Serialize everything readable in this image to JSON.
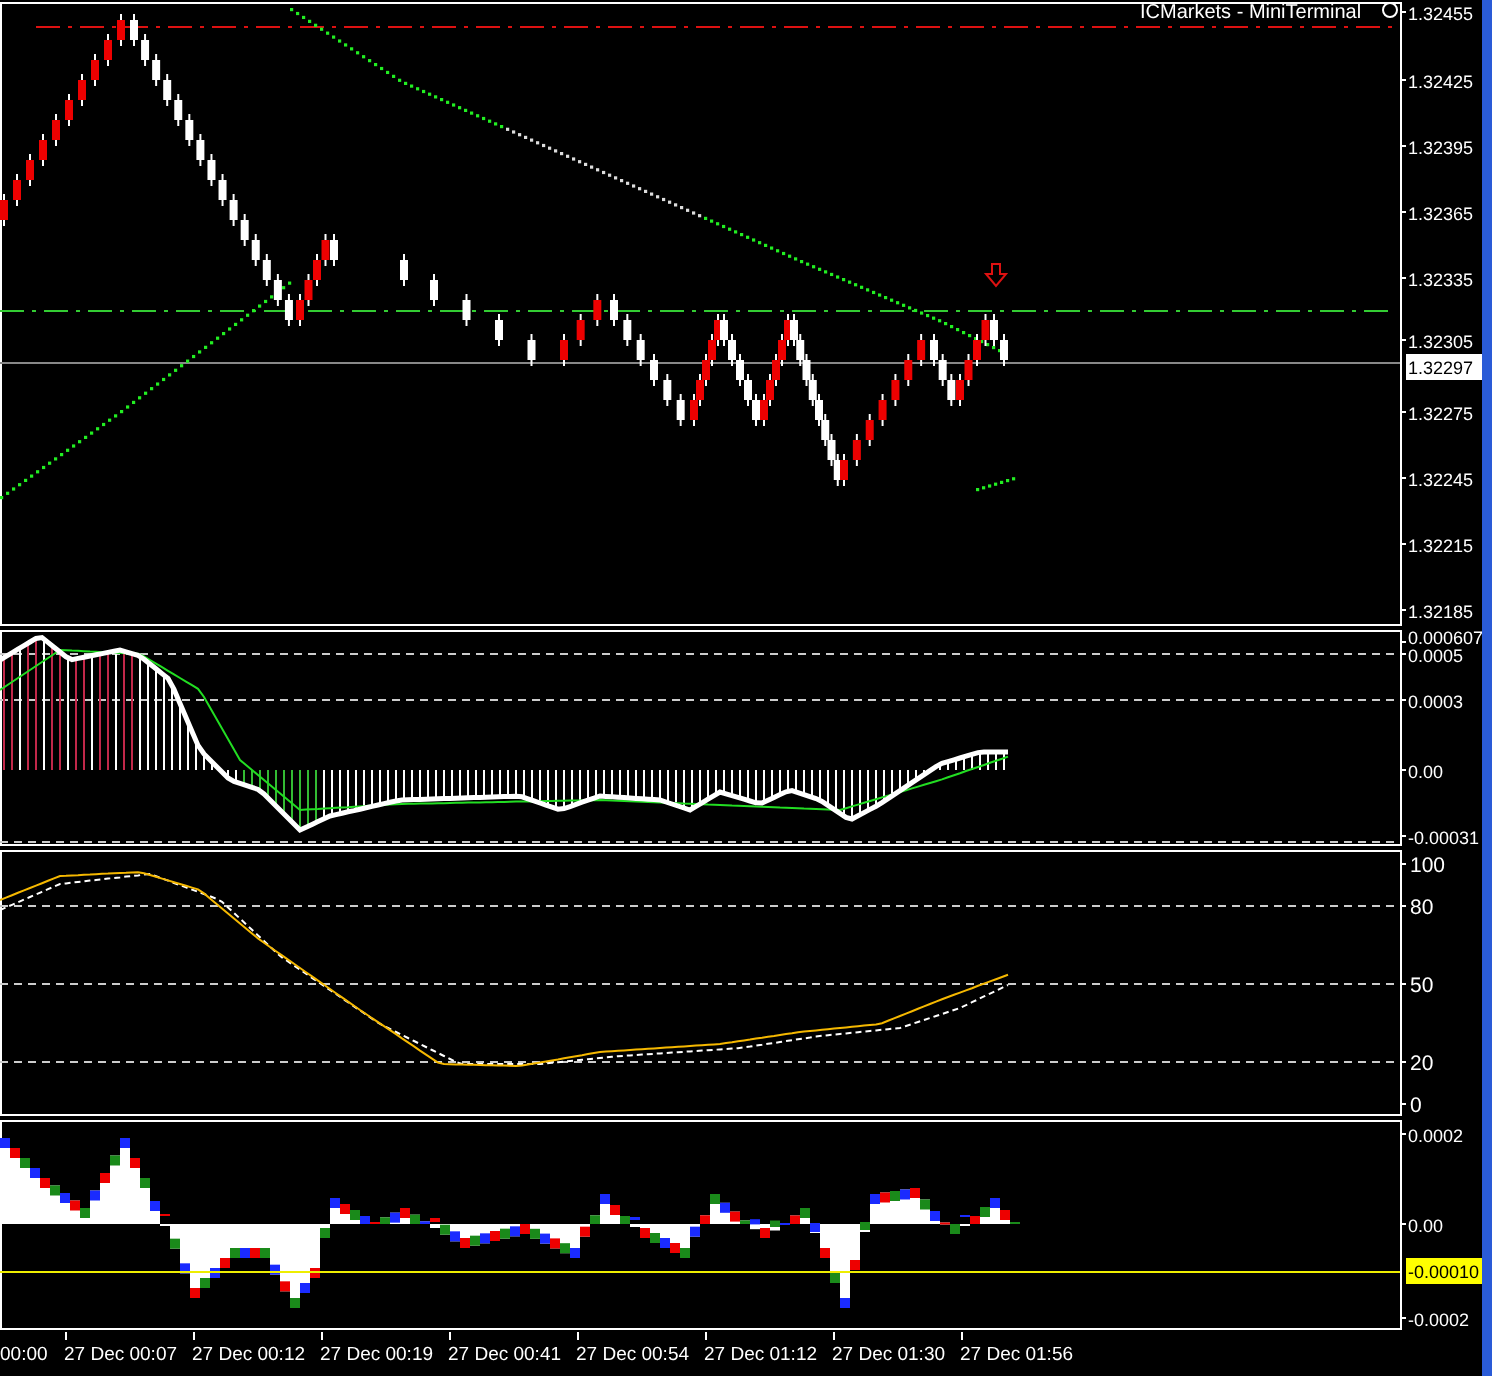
{
  "main_chart": {
    "title": "ICMarkets - MiniTerminal",
    "price_labels": [
      "1.32455",
      "1.32425",
      "1.32395",
      "1.32365",
      "1.32335",
      "1.32305",
      "1.32275",
      "1.32245",
      "1.32215",
      "1.32185"
    ],
    "current_price": "1.32297"
  },
  "macd_panel": {
    "scale_labels": [
      "0.000607",
      "0.0005",
      "0.0003",
      "0.00",
      "-0.00031"
    ]
  },
  "stochastic_panel": {
    "scale_labels": [
      "100",
      "80",
      "50",
      "20",
      "0"
    ]
  },
  "oscillator_panel": {
    "scale_labels": [
      "0.0002",
      "0.00",
      "-0.0002"
    ],
    "current_value": "-0.00010"
  },
  "time_axis": [
    "00:00",
    "27 Dec 00:07",
    "27 Dec 00:12",
    "27 Dec 00:19",
    "27 Dec 00:41",
    "27 Dec 00:54",
    "27 Dec 01:12",
    "27 Dec 01:30",
    "27 Dec 01:56"
  ]
}
